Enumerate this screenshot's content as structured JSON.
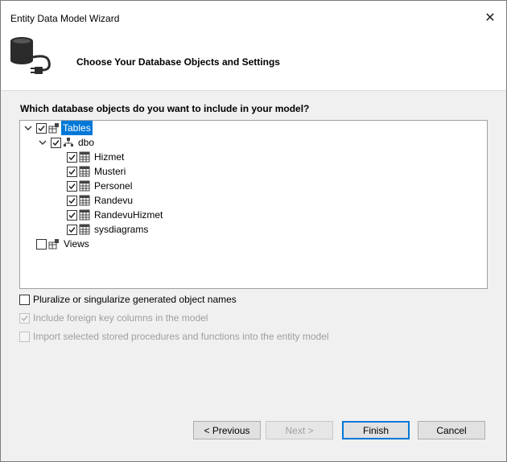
{
  "window": {
    "title": "Entity Data Model Wizard",
    "close_glyph": "✕"
  },
  "header": {
    "title": "Choose Your Database Objects and Settings",
    "icon": "database-plug-icon"
  },
  "question": "Which database objects do you want to include in your model?",
  "tree": {
    "tables": {
      "label": "Tables",
      "checked": true,
      "expanded": true,
      "selected": true
    },
    "dbo": {
      "label": "dbo",
      "checked": true,
      "expanded": true
    },
    "items": [
      {
        "label": "Hizmet",
        "checked": true
      },
      {
        "label": "Musteri",
        "checked": true
      },
      {
        "label": "Personel",
        "checked": true
      },
      {
        "label": "Randevu",
        "checked": true
      },
      {
        "label": "RandevuHizmet",
        "checked": true
      },
      {
        "label": "sysdiagrams",
        "checked": true
      }
    ],
    "views": {
      "label": "Views",
      "checked": false
    }
  },
  "options": {
    "pluralize": {
      "label": "Pluralize or singularize generated object names",
      "checked": false,
      "enabled": true
    },
    "foreign_keys": {
      "label": "Include foreign key columns in the model",
      "checked": true,
      "enabled": false
    },
    "stored_procs": {
      "label": "Import selected stored procedures and functions into the entity model",
      "checked": false,
      "enabled": false
    }
  },
  "buttons": {
    "previous": "< Previous",
    "next": "Next >",
    "finish": "Finish",
    "cancel": "Cancel"
  },
  "colors": {
    "selection": "#0078d7",
    "window_bg": "#f0f0f0"
  }
}
